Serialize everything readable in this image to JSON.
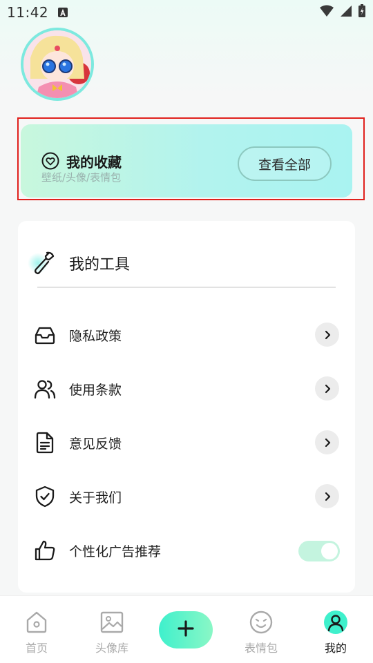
{
  "status_bar": {
    "time": "11:42"
  },
  "favorites": {
    "title": "我的收藏",
    "subtitle": "壁纸/头像/表情包",
    "view_all_label": "查看全部"
  },
  "tools": {
    "title": "我的工具",
    "items": [
      {
        "label": "隐私政策",
        "icon": "inbox-icon"
      },
      {
        "label": "使用条款",
        "icon": "users-icon"
      },
      {
        "label": "意见反馈",
        "icon": "document-icon"
      },
      {
        "label": "关于我们",
        "icon": "shield-check-icon"
      },
      {
        "label": "个性化广告推荐",
        "icon": "thumbs-up-icon",
        "toggle_on": true
      }
    ]
  },
  "bottom_nav": {
    "items": [
      {
        "label": "首页",
        "icon": "home-icon"
      },
      {
        "label": "头像库",
        "icon": "image-icon"
      },
      {
        "label": "",
        "icon": "plus-icon"
      },
      {
        "label": "表情包",
        "icon": "smiley-icon"
      },
      {
        "label": "我的",
        "icon": "user-icon",
        "active": true
      }
    ]
  },
  "colors": {
    "accent": "#3ff0cc",
    "highlight_border": "#e0201c",
    "card_gradient_start": "#c8f7dd",
    "card_gradient_end": "#a9f3f1"
  }
}
